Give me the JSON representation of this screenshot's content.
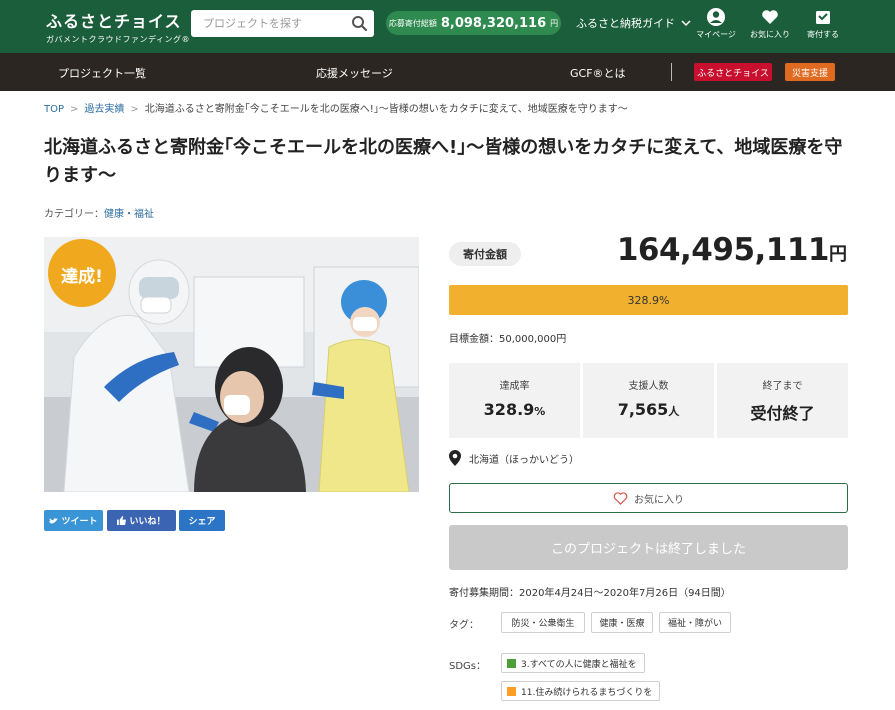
{
  "header": {
    "logo_main": "ふるさとチョイス",
    "logo_sub": "ガバメントクラウドファンディング®",
    "search_placeholder": "プロジェクトを探す",
    "total_label": "応募寄付総額",
    "total_amount": "8,098,320,116",
    "total_unit": "円",
    "guide_label": "ふるさと納税ガイド",
    "icons": [
      {
        "name": "mypage",
        "icon": "person-icon",
        "label": "マイページ"
      },
      {
        "name": "favorites",
        "icon": "heart-icon",
        "label": "お気に入り"
      },
      {
        "name": "donate",
        "icon": "gift-box-icon",
        "label": "寄付する"
      }
    ]
  },
  "nav": {
    "items": [
      "プロジェクト一覧",
      "応援メッセージ",
      "GCF®とは"
    ],
    "btn_furusato": "ふるさとチョイス",
    "btn_disaster": "災害支援",
    "colors": {
      "furusato": "#c8102e",
      "disaster": "#e06a1f"
    }
  },
  "breadcrumb": {
    "top": "TOP",
    "past": "過去実績",
    "current": "北海道ふるさと寄附金｢今こそエールを北の医療へ!｣〜皆様の想いをカタチに変えて、地域医療を守ります〜"
  },
  "project": {
    "title": "北海道ふるさと寄附金｢今こそエールを北の医療へ!｣〜皆様の想いをカタチに変えて、地域医療を守ります〜",
    "category_label": "カテゴリー：",
    "category_value": "健康・福祉",
    "achieved_badge": "達成!",
    "share": {
      "tweet": "ツイート",
      "like": "いいね！",
      "share": "シェア"
    }
  },
  "funding": {
    "amount_label": "寄付金額",
    "amount": "164,495,111",
    "amount_unit": "円",
    "progress_text": "328.9%",
    "progress_fraction": 1.0,
    "goal_text": "目標金額：50,000,000円",
    "stats": [
      {
        "label": "達成率",
        "value": "328.9",
        "unit": "%"
      },
      {
        "label": "支援人数",
        "value": "7,565",
        "unit": "人"
      },
      {
        "label": "終了まで",
        "value": "受付終了",
        "unit": ""
      }
    ],
    "location": "北海道（ほっかいどう）",
    "fav_button": "お気に入り",
    "ended_button": "このプロジェクトは終了しました",
    "period": "寄付募集期間：2020年4月24日～2020年7月26日（94日間）",
    "tags_label": "タグ：",
    "tags": [
      "防災・公衆衛生",
      "健康・医療",
      "福祉・障がい"
    ],
    "sdgs_label": "SDGs：",
    "sdgs": [
      {
        "label": "3.すべての人に健康と福祉を",
        "color": "#4c9f38"
      },
      {
        "label": "11.住み続けられるまちづくりを",
        "color": "#fd9d24"
      }
    ]
  }
}
